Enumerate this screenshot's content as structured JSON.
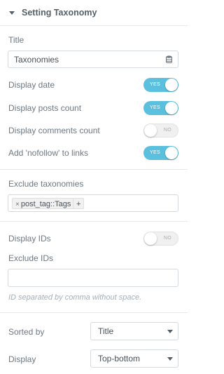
{
  "section": {
    "title": "Setting Taxonomy"
  },
  "title_field": {
    "label": "Title",
    "value": "Taxonomies"
  },
  "toggles": {
    "display_date": {
      "label": "Display date",
      "state": "YES"
    },
    "display_posts_count": {
      "label": "Display posts count",
      "state": "YES"
    },
    "display_comments_count": {
      "label": "Display comments count",
      "state": "NO"
    },
    "nofollow": {
      "label": "Add 'nofollow' to links",
      "state": "YES"
    },
    "display_ids": {
      "label": "Display IDs",
      "state": "NO"
    }
  },
  "exclude_taxonomies": {
    "label": "Exclude taxonomies",
    "tags": [
      {
        "remove": "×",
        "text": "post_tag::Tags"
      }
    ],
    "add": "+"
  },
  "exclude_ids": {
    "label": "Exclude IDs",
    "value": "",
    "hint": "ID separated by comma without space."
  },
  "sorted_by": {
    "label": "Sorted by",
    "value": "Title"
  },
  "display": {
    "label": "Display",
    "value": "Top-bottom"
  },
  "colors": {
    "switch_on": "#5bc0de",
    "switch_off": "#f0f0f0",
    "border": "#d5dadf",
    "text": "#6d7882"
  }
}
